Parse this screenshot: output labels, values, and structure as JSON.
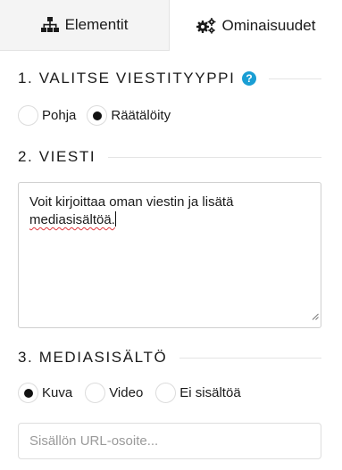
{
  "tabs": [
    {
      "label": "Elementit",
      "icon": "sitemap-icon",
      "active": false
    },
    {
      "label": "Ominaisuudet",
      "icon": "cogs-icon",
      "active": true
    }
  ],
  "sections": {
    "message_type": {
      "title": "1. VALITSE VIESTITYYPPI",
      "help_icon": "question-circle-icon",
      "options": [
        {
          "label": "Pohja",
          "checked": false
        },
        {
          "label": "Räätälöity",
          "checked": true
        }
      ]
    },
    "message": {
      "title": "2. VIESTI",
      "text_line1": "Voit kirjoittaa oman viestin ja lisätä",
      "text_line2": "mediasisältöä."
    },
    "media": {
      "title": "3. MEDIASISÄLTÖ",
      "options": [
        {
          "label": "Kuva",
          "checked": true
        },
        {
          "label": "Video",
          "checked": false
        },
        {
          "label": "Ei sisältöä",
          "checked": false
        }
      ],
      "url_placeholder": "Sisällön URL-osoite..."
    }
  },
  "colors": {
    "accent": "#1a9ed4",
    "inactive_tab_bg": "#f4f4f4",
    "spellcheck": "#e0383e"
  }
}
